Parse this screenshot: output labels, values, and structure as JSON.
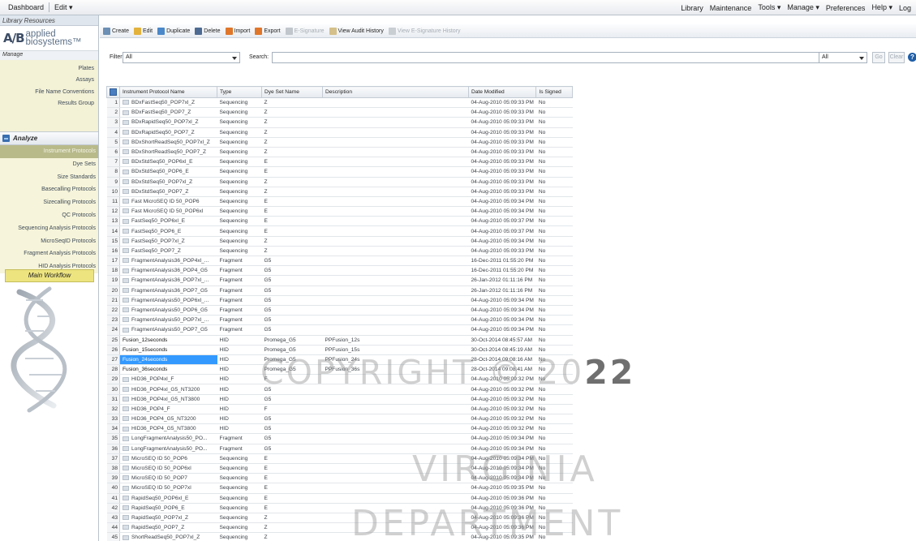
{
  "topbar": {
    "left": [
      "Dashboard",
      "Edit ▾"
    ],
    "right": [
      "Library",
      "Maintenance",
      "Tools ▾",
      "Manage ▾",
      "Preferences",
      "Help ▾",
      "Log"
    ]
  },
  "sidebar": {
    "header": "Library Resources",
    "logo": {
      "mark": "A/B",
      "line1": "applied",
      "line2": "biosystems™"
    },
    "manage_header": "Manage",
    "manage_items": [
      "Plates",
      "Assays",
      "File Name Conventions",
      "Results Group"
    ],
    "analyze_header": "Analyze",
    "analyze_items": [
      {
        "label": "Instrument Protocols",
        "selected": true
      },
      {
        "label": "Dye Sets"
      },
      {
        "label": "Size Standards"
      },
      {
        "label": "Basecalling Protocols"
      },
      {
        "label": "Sizecalling Protocols"
      },
      {
        "label": "QC Protocols"
      },
      {
        "label": "Sequencing Analysis Protocols"
      },
      {
        "label": "MicroSeqID Protocols"
      },
      {
        "label": "Fragment Analysis Protocols"
      },
      {
        "label": "HID Analysis Protocols"
      }
    ],
    "workflow_label": "Main Workflow"
  },
  "toolbar": [
    {
      "label": "Create",
      "icon": "create-icon",
      "color": "#6b8fb5",
      "enabled": true
    },
    {
      "label": "Edit",
      "icon": "edit-icon",
      "color": "#e3b23c",
      "enabled": true
    },
    {
      "label": "Duplicate",
      "icon": "duplicate-icon",
      "color": "#4a88c9",
      "enabled": true
    },
    {
      "label": "Delete",
      "icon": "delete-icon",
      "color": "#4d6b92",
      "enabled": true
    },
    {
      "label": "Import",
      "icon": "import-icon",
      "color": "#e0762a",
      "enabled": true
    },
    {
      "label": "Export",
      "icon": "export-icon",
      "color": "#e0762a",
      "enabled": true
    },
    {
      "label": "E-Signature",
      "icon": "esignature-icon",
      "color": "#c0c6cc",
      "enabled": false
    },
    {
      "label": "View Audit History",
      "icon": "audit-icon",
      "color": "#d4c08a",
      "enabled": true
    },
    {
      "label": "View E-Signature History",
      "icon": "esig-history-icon",
      "color": "#c9ced3",
      "enabled": false
    }
  ],
  "filter": {
    "label": "Filter:",
    "value": "All",
    "search_label": "Search:",
    "search_value": "",
    "scope": "All",
    "go": "Go",
    "clear": "Clear",
    "help": "?"
  },
  "columns": [
    "Instrument Protocol Name",
    "Type",
    "Dye Set Name",
    "Description",
    "Date Modified",
    "Is Signed"
  ],
  "rows": [
    [
      "1",
      "BDxFastSeq50_POP7xl_Z",
      "Sequencing",
      "Z",
      "",
      "04-Aug-2010 05:09:33 PM",
      "No"
    ],
    [
      "2",
      "BDxFastSeq50_POP7_Z",
      "Sequencing",
      "Z",
      "",
      "04-Aug-2010 05:09:33 PM",
      "No"
    ],
    [
      "3",
      "BDxRapidSeq50_POP7xl_Z",
      "Sequencing",
      "Z",
      "",
      "04-Aug-2010 05:09:33 PM",
      "No"
    ],
    [
      "4",
      "BDxRapidSeq50_POP7_Z",
      "Sequencing",
      "Z",
      "",
      "04-Aug-2010 05:09:33 PM",
      "No"
    ],
    [
      "5",
      "BDxShortReadSeq50_POP7xl_Z",
      "Sequencing",
      "Z",
      "",
      "04-Aug-2010 05:09:33 PM",
      "No"
    ],
    [
      "6",
      "BDxShortReadSeq50_POP7_Z",
      "Sequencing",
      "Z",
      "",
      "04-Aug-2010 05:09:33 PM",
      "No"
    ],
    [
      "7",
      "BDxStdSeq50_POP6xl_E",
      "Sequencing",
      "E",
      "",
      "04-Aug-2010 05:09:33 PM",
      "No"
    ],
    [
      "8",
      "BDxStdSeq50_POP6_E",
      "Sequencing",
      "E",
      "",
      "04-Aug-2010 05:09:33 PM",
      "No"
    ],
    [
      "9",
      "BDxStdSeq50_POP7xl_Z",
      "Sequencing",
      "Z",
      "",
      "04-Aug-2010 05:09:33 PM",
      "No"
    ],
    [
      "10",
      "BDxStdSeq50_POP7_Z",
      "Sequencing",
      "Z",
      "",
      "04-Aug-2010 05:09:33 PM",
      "No"
    ],
    [
      "11",
      "Fast MicroSEQ ID 50_POP6",
      "Sequencing",
      "E",
      "",
      "04-Aug-2010 05:09:34 PM",
      "No"
    ],
    [
      "12",
      "Fast MicroSEQ ID 50_POP6xl",
      "Sequencing",
      "E",
      "",
      "04-Aug-2010 05:09:34 PM",
      "No"
    ],
    [
      "13",
      "FastSeq50_POP6xl_E",
      "Sequencing",
      "E",
      "",
      "04-Aug-2010 05:09:37 PM",
      "No"
    ],
    [
      "14",
      "FastSeq50_POP6_E",
      "Sequencing",
      "E",
      "",
      "04-Aug-2010 05:09:37 PM",
      "No"
    ],
    [
      "15",
      "FastSeq50_POP7xl_Z",
      "Sequencing",
      "Z",
      "",
      "04-Aug-2010 05:09:34 PM",
      "No"
    ],
    [
      "16",
      "FastSeq50_POP7_Z",
      "Sequencing",
      "Z",
      "",
      "04-Aug-2010 05:09:33 PM",
      "No"
    ],
    [
      "17",
      "FragmentAnalysis36_POP4xl_...",
      "Fragment",
      "G5",
      "",
      "16-Dec-2011 01:55:20 PM",
      "No"
    ],
    [
      "18",
      "FragmentAnalysis36_POP4_G5",
      "Fragment",
      "G5",
      "",
      "16-Dec-2011 01:55:20 PM",
      "No"
    ],
    [
      "19",
      "FragmentAnalysis36_POP7xl_...",
      "Fragment",
      "G5",
      "",
      "26-Jan-2012 01:11:16 PM",
      "No"
    ],
    [
      "20",
      "FragmentAnalysis36_POP7_G5",
      "Fragment",
      "G5",
      "",
      "26-Jan-2012 01:11:16 PM",
      "No"
    ],
    [
      "21",
      "FragmentAnalysis50_POP6xl_...",
      "Fragment",
      "G5",
      "",
      "04-Aug-2010 05:09:34 PM",
      "No"
    ],
    [
      "22",
      "FragmentAnalysis50_POP6_G5",
      "Fragment",
      "G5",
      "",
      "04-Aug-2010 05:09:34 PM",
      "No"
    ],
    [
      "23",
      "FragmentAnalysis50_POP7xl_...",
      "Fragment",
      "G5",
      "",
      "04-Aug-2010 05:09:34 PM",
      "No"
    ],
    [
      "24",
      "FragmentAnalysis50_POP7_G5",
      "Fragment",
      "G5",
      "",
      "04-Aug-2010 05:09:34 PM",
      "No"
    ],
    [
      "25",
      "Fusion_12seconds",
      "HID",
      "Promega_G5",
      "PPFusion_12s",
      "30-Oct-2014 08:45:57 AM",
      "No"
    ],
    [
      "26",
      "Fusion_15seconds",
      "HID",
      "Promega_G5",
      "PPFusion_15s",
      "30-Oct-2014 08:45:19 AM",
      "No"
    ],
    [
      "27",
      "Fusion_24seconds",
      "HID",
      "Promega_G5",
      "PPFusion_24s",
      "28-Oct-2014 09:08:16 AM",
      "No"
    ],
    [
      "28",
      "Fusion_36seconds",
      "HID",
      "Promega_G5",
      "PPFusion_36s",
      "28-Oct-2014 09:08:41 AM",
      "No"
    ],
    [
      "29",
      "HID36_POP4xl_F",
      "HID",
      "F",
      "",
      "04-Aug-2010 05:09:32 PM",
      "No"
    ],
    [
      "30",
      "HID36_POP4xl_G5_NT3200",
      "HID",
      "G5",
      "",
      "04-Aug-2010 05:09:32 PM",
      "No"
    ],
    [
      "31",
      "HID36_POP4xl_G5_NT3800",
      "HID",
      "G5",
      "",
      "04-Aug-2010 05:09:32 PM",
      "No"
    ],
    [
      "32",
      "HID36_POP4_F",
      "HID",
      "F",
      "",
      "04-Aug-2010 05:09:32 PM",
      "No"
    ],
    [
      "33",
      "HID36_POP4_G5_NT3200",
      "HID",
      "G5",
      "",
      "04-Aug-2010 05:09:32 PM",
      "No"
    ],
    [
      "34",
      "HID36_POP4_G5_NT3800",
      "HID",
      "G5",
      "",
      "04-Aug-2010 05:09:32 PM",
      "No"
    ],
    [
      "35",
      "LongFragmentAnalysis50_PO...",
      "Fragment",
      "G5",
      "",
      "04-Aug-2010 05:09:34 PM",
      "No"
    ],
    [
      "36",
      "LongFragmentAnalysis50_PO...",
      "Fragment",
      "G5",
      "",
      "04-Aug-2010 05:09:34 PM",
      "No"
    ],
    [
      "37",
      "MicroSEQ ID 50_POP6",
      "Sequencing",
      "E",
      "",
      "04-Aug-2010 05:09:34 PM",
      "No"
    ],
    [
      "38",
      "MicroSEQ ID 50_POP6xl",
      "Sequencing",
      "E",
      "",
      "04-Aug-2010 05:09:34 PM",
      "No"
    ],
    [
      "39",
      "MicroSEQ ID 50_POP7",
      "Sequencing",
      "E",
      "",
      "04-Aug-2010 05:09:34 PM",
      "No"
    ],
    [
      "40",
      "MicroSEQ ID 50_POP7xl",
      "Sequencing",
      "E",
      "",
      "04-Aug-2010 05:09:35 PM",
      "No"
    ],
    [
      "41",
      "RapidSeq50_POP6xl_E",
      "Sequencing",
      "E",
      "",
      "04-Aug-2010 05:09:36 PM",
      "No"
    ],
    [
      "42",
      "RapidSeq50_POP6_E",
      "Sequencing",
      "E",
      "",
      "04-Aug-2010 05:09:36 PM",
      "No"
    ],
    [
      "43",
      "RapidSeq50_POP7xl_Z",
      "Sequencing",
      "Z",
      "",
      "04-Aug-2010 05:09:36 PM",
      "No"
    ],
    [
      "44",
      "RapidSeq50_POP7_Z",
      "Sequencing",
      "Z",
      "",
      "04-Aug-2010 05:09:36 PM",
      "No"
    ],
    [
      "45",
      "ShortReadSeq50_POP7xl_Z",
      "Sequencing",
      "Z",
      "",
      "04-Aug-2010 05:09:35 PM",
      "No"
    ]
  ],
  "selected_row": 27,
  "watermark": {
    "line1": "COPYRIGHT © 20",
    "line1_bold": "22",
    "line2": "VIRGINIA",
    "line3": "DEPARTMENT"
  }
}
